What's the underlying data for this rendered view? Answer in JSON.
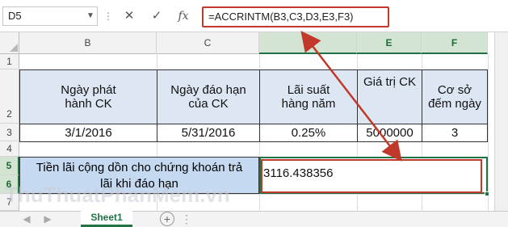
{
  "name_box": "D5",
  "formula": "=ACCRINTM(B3,C3,D3,E3,F3)",
  "formula_buttons": {
    "cancel": "✕",
    "enter": "✓",
    "fx": "fx"
  },
  "columns": [
    "B",
    "C",
    "D",
    "E",
    "F"
  ],
  "rows": [
    "1",
    "2",
    "3",
    "4",
    "5",
    "6",
    "7"
  ],
  "table": {
    "headers": [
      {
        "line1": "Ngày phát",
        "line2": "hành CK"
      },
      {
        "line1": "Ngày đáo hạn",
        "line2": "của CK"
      },
      {
        "line1": "Lãi suất",
        "line2": "hàng năm"
      },
      {
        "line1": "Giá trị CK",
        "line2": ""
      },
      {
        "line1": "Cơ sở",
        "line2": "đếm ngày"
      }
    ],
    "values": [
      "3/1/2016",
      "5/31/2016",
      "0.25%",
      "5000000",
      "3"
    ]
  },
  "label": {
    "line1": "Tiền lãi cộng dồn cho chứng khoán trả",
    "line2": "lãi khi đáo hạn"
  },
  "result": "3116.438356",
  "sheet_tab": "Sheet1",
  "watermark": "ThuThuatPhanMem.vn",
  "colors": {
    "accent": "#217346",
    "highlight": "#c0392b",
    "header_fill": "#dde7f3"
  }
}
